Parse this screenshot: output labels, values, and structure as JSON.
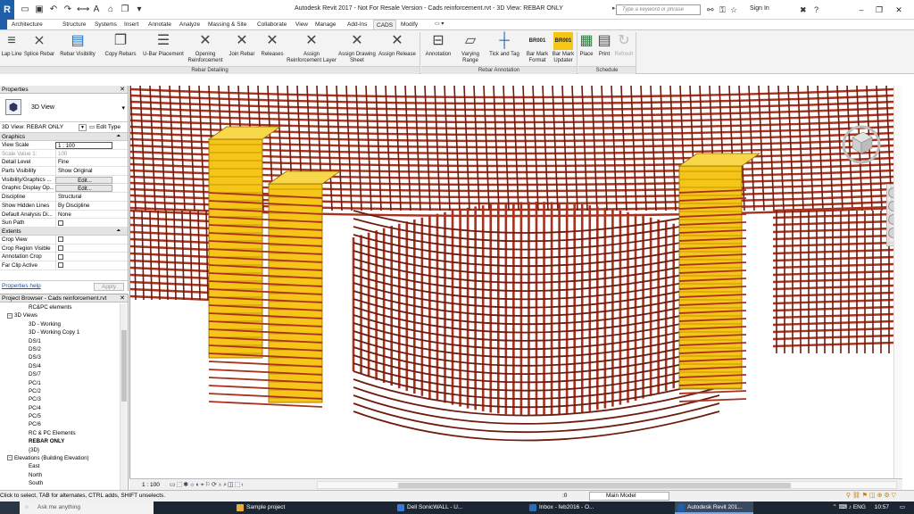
{
  "window": {
    "title": "Autodesk Revit 2017 - Not For Resale Version -   Cads reinforcement.rvt - 3D View: REBAR ONLY",
    "search_placeholder": "Type a keyword or phrase",
    "signin": "Sign In",
    "app_logo": "R"
  },
  "ribbon_tabs": [
    "Architecture",
    "Structure",
    "Systems",
    "Insert",
    "Annotate",
    "Analyze",
    "Massing & Site",
    "Collaborate",
    "View",
    "Manage",
    "Add-Ins",
    "CADS",
    "Modify"
  ],
  "active_tab": "CADS",
  "ribbon": {
    "rebar_detailing": {
      "label": "Rebar Detailing",
      "buttons": [
        {
          "label": "Lap Line",
          "icon": "lap-line-icon"
        },
        {
          "label": "Splice Rebar",
          "icon": "splice-rebar-icon"
        },
        {
          "label": "Rebar Visibility",
          "icon": "rebar-visibility-icon"
        },
        {
          "label": "Copy Rebars",
          "icon": "copy-rebars-icon"
        },
        {
          "label": "U-Bar Placement",
          "icon": "u-bar-icon"
        },
        {
          "label": "Opening Reinforcement",
          "icon": "opening-reinforcement-icon"
        },
        {
          "label": "Join Rebar",
          "icon": "join-rebar-icon"
        },
        {
          "label": "Releases",
          "icon": "releases-icon"
        },
        {
          "label": "Assign Reinforcement Layer",
          "icon": "assign-layer-icon"
        },
        {
          "label": "Assign Drawing Sheet",
          "icon": "assign-sheet-icon"
        },
        {
          "label": "Assign Release",
          "icon": "assign-release-icon"
        }
      ]
    },
    "rebar_annotation": {
      "label": "Rebar Annotation",
      "buttons": [
        {
          "label": "Annotation",
          "icon": "annotation-icon"
        },
        {
          "label": "Varying Range",
          "icon": "varying-range-icon"
        },
        {
          "label": "Tick and Tag",
          "icon": "tick-tag-icon"
        },
        {
          "label": "Bar Mark Format",
          "icon": "bar-mark-format-icon",
          "badge": "BR001"
        },
        {
          "label": "Bar Mark Updater",
          "icon": "bar-mark-updater-icon",
          "badge": "BR001"
        }
      ]
    },
    "schedule": {
      "label": "Schedule",
      "buttons": [
        {
          "label": "Place",
          "icon": "place-icon"
        },
        {
          "label": "Print",
          "icon": "print-icon"
        },
        {
          "label": "Refresh",
          "icon": "refresh-icon"
        }
      ]
    }
  },
  "properties": {
    "title": "Properties",
    "type_name": "3D View",
    "view_selector": "3D View: REBAR ONLY",
    "edit_type": "Edit Type",
    "groups": {
      "graphics": "Graphics",
      "extents": "Extents"
    },
    "graphics_rows": [
      {
        "key": "View Scale",
        "value": "1 : 100",
        "style": "boxed"
      },
      {
        "key": "Scale Value    1:",
        "value": "100",
        "style": "dim"
      },
      {
        "key": "Detail Level",
        "value": "Fine"
      },
      {
        "key": "Parts Visibility",
        "value": "Show Original"
      },
      {
        "key": "Visibility/Graphics ...",
        "value": "Edit...",
        "style": "btn"
      },
      {
        "key": "Graphic Display Op...",
        "value": "Edit...",
        "style": "btn"
      },
      {
        "key": "Discipline",
        "value": "Structural"
      },
      {
        "key": "Show Hidden Lines",
        "value": "By Discipline"
      },
      {
        "key": "Default Analysis Di...",
        "value": "None"
      },
      {
        "key": "Sun Path",
        "value": "",
        "style": "check"
      }
    ],
    "extents_rows": [
      {
        "key": "Crop View",
        "value": "",
        "style": "check"
      },
      {
        "key": "Crop Region Visible",
        "value": "",
        "style": "check"
      },
      {
        "key": "Annotation Crop",
        "value": "",
        "style": "check"
      },
      {
        "key": "Far Clip Active",
        "value": "",
        "style": "check"
      }
    ],
    "help_link": "Properties help",
    "apply": "Apply"
  },
  "project_browser": {
    "title": "Project Browser - Cads reinforcement.rvt",
    "items": [
      {
        "label": "RC&PC elements",
        "indent": 32,
        "expander": ""
      },
      {
        "label": "3D Views",
        "indent": 8,
        "expander": "−"
      },
      {
        "label": "3D - Working",
        "indent": 32,
        "expander": ""
      },
      {
        "label": "3D - Working Copy 1",
        "indent": 32,
        "expander": ""
      },
      {
        "label": "DS/1",
        "indent": 32,
        "expander": ""
      },
      {
        "label": "DS/2",
        "indent": 32,
        "expander": ""
      },
      {
        "label": "DS/3",
        "indent": 32,
        "expander": ""
      },
      {
        "label": "DS/4",
        "indent": 32,
        "expander": ""
      },
      {
        "label": "DS/7",
        "indent": 32,
        "expander": ""
      },
      {
        "label": "PC/1",
        "indent": 32,
        "expander": ""
      },
      {
        "label": "PC/2",
        "indent": 32,
        "expander": ""
      },
      {
        "label": "PC/3",
        "indent": 32,
        "expander": ""
      },
      {
        "label": "PC/4",
        "indent": 32,
        "expander": ""
      },
      {
        "label": "PC/5",
        "indent": 32,
        "expander": ""
      },
      {
        "label": "PC/6",
        "indent": 32,
        "expander": ""
      },
      {
        "label": "RC & PC Elements",
        "indent": 32,
        "expander": ""
      },
      {
        "label": "REBAR ONLY",
        "indent": 32,
        "expander": "",
        "selected": true
      },
      {
        "label": "{3D}",
        "indent": 32,
        "expander": ""
      },
      {
        "label": "Elevations (Building Elevation)",
        "indent": 8,
        "expander": "−"
      },
      {
        "label": "East",
        "indent": 32,
        "expander": ""
      },
      {
        "label": "North",
        "indent": 32,
        "expander": ""
      },
      {
        "label": "South",
        "indent": 32,
        "expander": ""
      }
    ]
  },
  "view_control": {
    "scale": "1 : 100"
  },
  "statusbar": {
    "text": "Click to select, TAB for alternates, CTRL adds, SHIFT unselects.",
    "count": ":0",
    "model": "Main Model"
  },
  "taskbar": {
    "search": "Ask me anything",
    "items": [
      {
        "label": "Sample project",
        "color": "#e8b03a"
      },
      {
        "label": "Dell SonicWALL - U...",
        "color": "#3a7bd5"
      },
      {
        "label": "Inbox - feb2016 - O...",
        "color": "#2a6ebb"
      },
      {
        "label": "Autodesk Revit 201...",
        "color": "#1f5fa8",
        "active": true
      }
    ],
    "lang": "ENG",
    "time": "10:57"
  },
  "colors": {
    "rebar": "#a8321e",
    "rebar_dark": "#6e1c0e",
    "element_yellow": "#f5c518",
    "accent": "#1f5fa8"
  }
}
